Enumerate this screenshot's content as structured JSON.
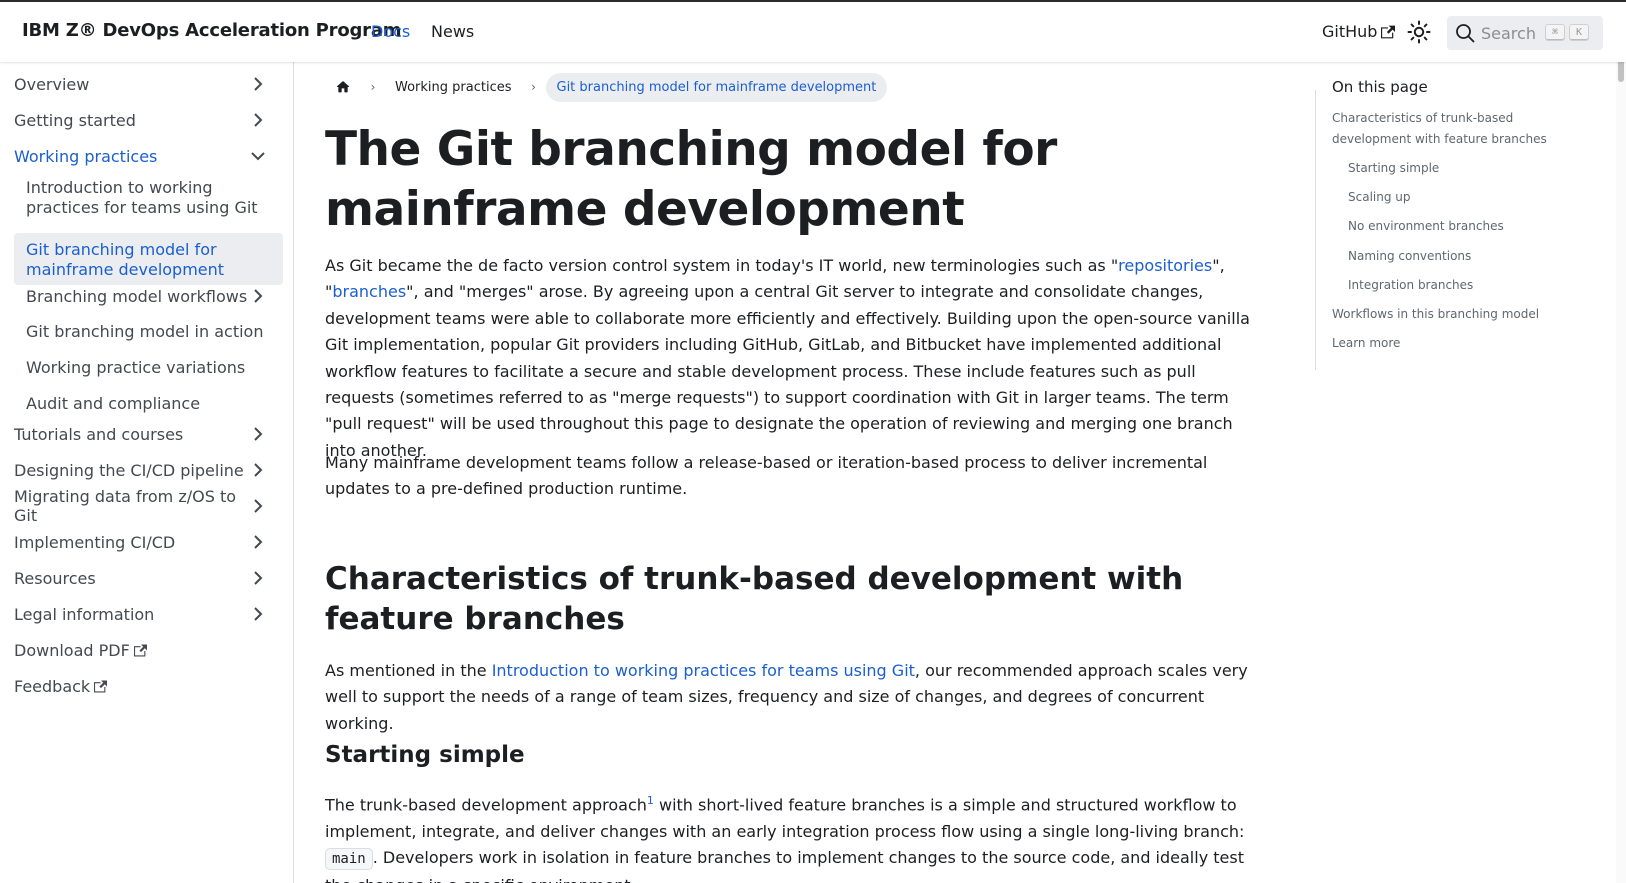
{
  "navbar": {
    "brand": "IBM Z® DevOps Acceleration Program",
    "links": [
      "Docs",
      "News"
    ],
    "github": "GitHub",
    "search_placeholder": "Search",
    "search_keys": [
      "⌘",
      "K"
    ]
  },
  "sidebar": {
    "items": [
      {
        "label": "Overview"
      },
      {
        "label": "Getting started"
      },
      {
        "label": "Working practices"
      },
      {
        "label": "Introduction to working practices for teams using Git"
      },
      {
        "label": "Git branching model for mainframe development"
      },
      {
        "label": "Branching model workflows"
      },
      {
        "label": "Git branching model in action"
      },
      {
        "label": "Working practice variations"
      },
      {
        "label": "Audit and compliance"
      },
      {
        "label": "Tutorials and courses"
      },
      {
        "label": "Designing the CI/CD pipeline"
      },
      {
        "label": "Migrating data from z/OS to Git"
      },
      {
        "label": "Implementing CI/CD"
      },
      {
        "label": "Resources"
      },
      {
        "label": "Legal information"
      },
      {
        "label": "Download PDF"
      },
      {
        "label": "Feedback"
      }
    ]
  },
  "breadcrumbs": {
    "items": [
      "Working practices",
      "Git branching model for mainframe development"
    ]
  },
  "article": {
    "title": "The Git branching model for mainframe development",
    "p1": {
      "t1": "As Git became the de facto version control system in today's IT world, new terminologies such as \"",
      "link1": "repositories",
      "t2": "\", \"",
      "link2": "branches",
      "t3": "\", and \"merges\" arose. By agreeing upon a central Git server to integrate and consolidate changes, development teams were able to collaborate more efficiently and effectively. Building upon the open-source vanilla Git implementation, popular Git providers including GitHub, GitLab, and Bitbucket have implemented additional workflow features to facilitate a secure and stable development process. These include features such as pull requests (sometimes referred to as \"merge requests\") to support coordination with Git in larger teams. The term \"pull request\" will be used throughout this page to designate the operation of reviewing and merging one branch into another."
    },
    "p2": "Many mainframe development teams follow a release-based or iteration-based process to deliver incremental updates to a pre-defined production runtime.",
    "h2": "Characteristics of trunk-based development with feature branches",
    "p3": {
      "t1": "As mentioned in the ",
      "link": "Introduction to working practices for teams using Git",
      "t2": ", our recommended approach scales very well to support the needs of a range of team sizes, frequency and size of changes, and degrees of concurrent working."
    },
    "h3": "Starting simple",
    "p4": {
      "t1": "The trunk-based development approach",
      "footnote": "1",
      "t2": " with short-lived feature branches is a simple and structured workflow to implement, integrate, and deliver changes with an early integration process flow using a single long-living branch: ",
      "code": "main",
      "t3": ". Developers work in isolation in feature branches to implement changes to the source code, and ideally test the changes in a specific environment."
    }
  },
  "toc": {
    "title": "On this page",
    "links": [
      "Characteristics of trunk-based development with feature branches",
      "Starting simple",
      "Scaling up",
      "No environment branches",
      "Naming conventions",
      "Integration branches",
      "Workflows in this branching model",
      "Learn more"
    ]
  },
  "colors": {
    "link": "#1a5fd0",
    "text": "#1c1e21",
    "active_bg": "#ebedf0"
  }
}
